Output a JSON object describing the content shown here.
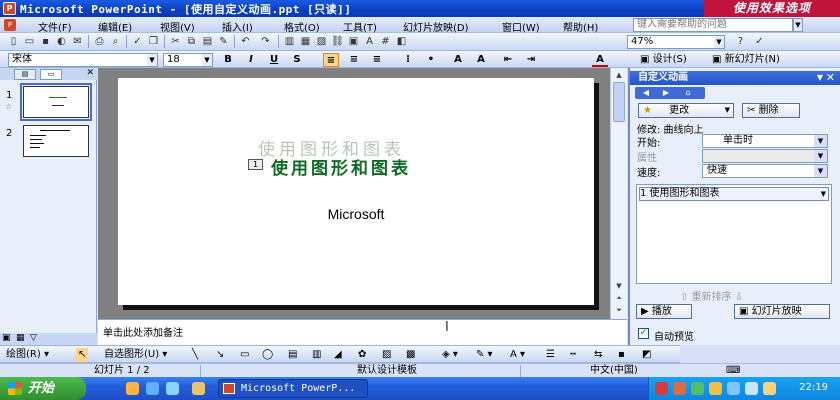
{
  "window": {
    "title": "Microsoft PowerPoint - [使用自定义动画.ppt [只读]]",
    "badge": "使用效果选项"
  },
  "menu": {
    "items": [
      "文件(F)",
      "编辑(E)",
      "视图(V)",
      "插入(I)",
      "格式(O)",
      "工具(T)",
      "幻灯片放映(D)",
      "窗口(W)",
      "帮助(H)"
    ],
    "help_placeholder": "键入需要帮助的问题"
  },
  "toolbar": {
    "zoom": "47%",
    "design_label": "设计(S)",
    "new_slide_label": "新幻灯片(N)"
  },
  "format_bar": {
    "font": "宋体",
    "size": "18",
    "bold": "B",
    "italic": "I",
    "underline": "U",
    "shadow": "S"
  },
  "slides_pane": {
    "slides": [
      {
        "number": "1"
      },
      {
        "number": "2"
      }
    ]
  },
  "slide": {
    "ghost_title": "使用图形和图表",
    "anim_tag": "1",
    "title": "使用图形和图表",
    "subtitle": "Microsoft"
  },
  "notes": {
    "placeholder": "单击此处添加备注"
  },
  "task_pane": {
    "title": "自定义动画",
    "change_label": "更改",
    "remove_label": "删除",
    "modify_label": "修改: 曲线向上",
    "start_label": "开始:",
    "start_value": "单击时",
    "property_label": "属性",
    "speed_label": "速度:",
    "speed_value": "快速",
    "list_item": "1 使用图形和图表",
    "reorder_label": "重新排序",
    "play_label": "播放",
    "slideshow_label": "幻灯片放映",
    "autopreview_label": "自动预览",
    "autopreview_checked": true
  },
  "draw_bar": {
    "draw_label": "绘图(R)",
    "autoshapes_label": "自选图形(U)"
  },
  "status": {
    "slide_info": "幻灯片 1 / 2",
    "template": "默认设计模板",
    "language": "中文(中国)"
  },
  "taskbar": {
    "start": "开始",
    "app_button": "Microsoft PowerP...",
    "clock": "22:19"
  }
}
